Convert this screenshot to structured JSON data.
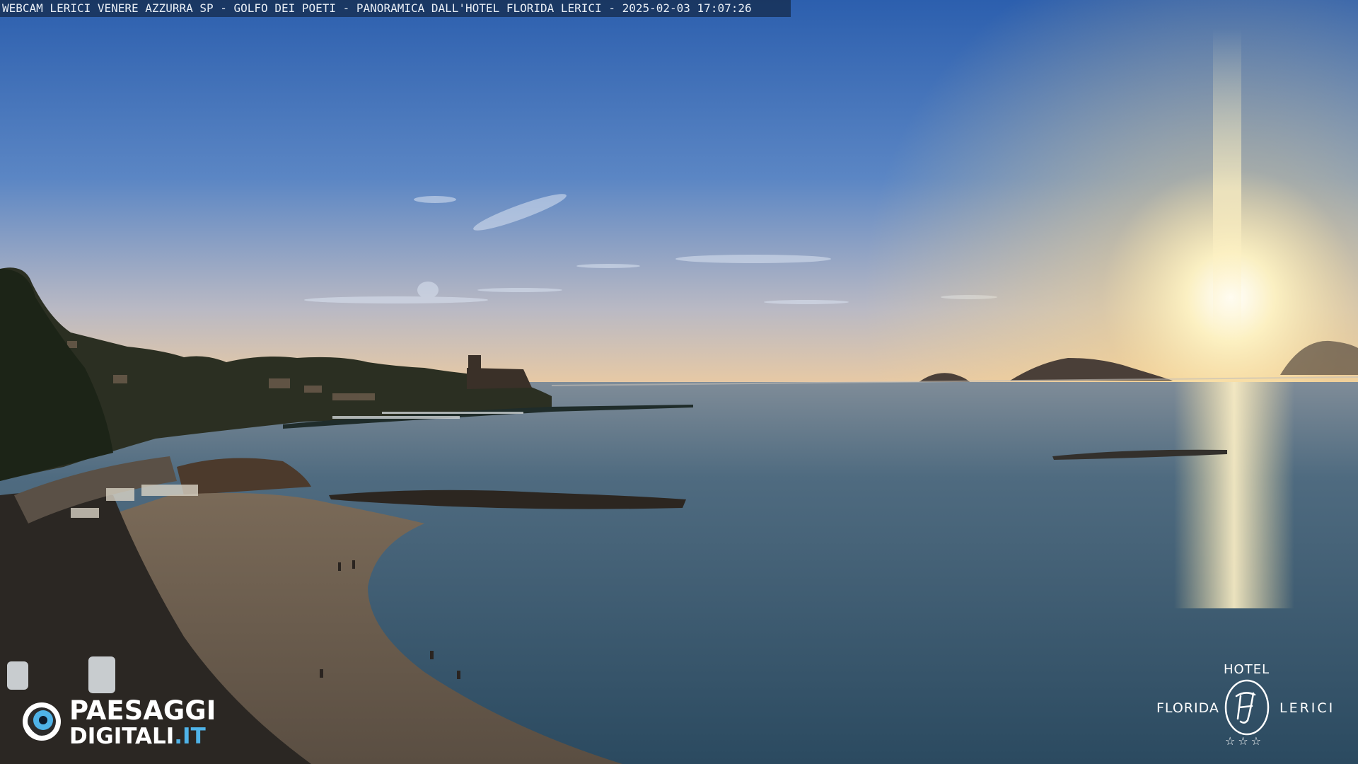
{
  "overlay": {
    "title": "WEBCAM LERICI VENERE AZZURRA SP - GOLFO DEI POETI - PANORAMICA DALL'HOTEL FLORIDA LERICI - 2025-02-03 17:07:26"
  },
  "logo_left": {
    "line1": "PAESAGGI",
    "line2_main": "DIGITALI",
    "line2_suffix": ".IT"
  },
  "logo_right": {
    "top": "HOTEL",
    "left": "FLORIDA",
    "right": "LERICI",
    "stars": "☆☆☆"
  },
  "colors": {
    "sky_top": "#2d63b0",
    "sky_horizon": "#e9c9a6",
    "sea": "#3a5c74",
    "sun": "#fff6d8",
    "logo_accent": "#4fb3e8"
  }
}
